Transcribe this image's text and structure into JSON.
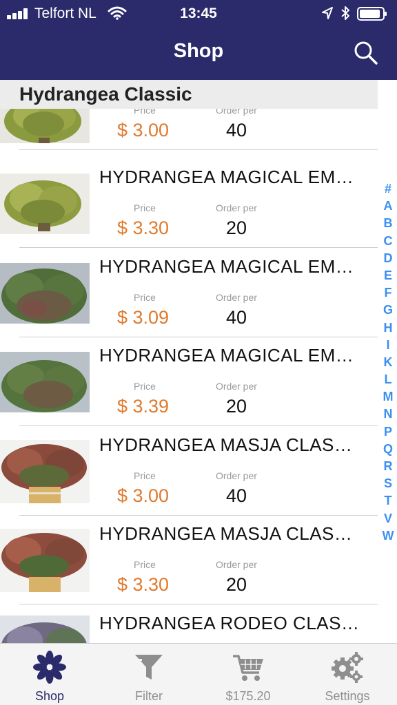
{
  "status_bar": {
    "carrier": "Telfort NL",
    "time": "13:45"
  },
  "nav": {
    "title": "Shop",
    "search_icon": "search-icon"
  },
  "section": {
    "title": "Hydrangea Classic"
  },
  "columns": {
    "price_label": "Price",
    "order_label": "Order per"
  },
  "products": [
    {
      "name": "",
      "price": "$ 3.00",
      "order_per": "40",
      "image_style": "green"
    },
    {
      "name": "HYDRANGEA MAGICAL EM…",
      "price": "$ 3.30",
      "order_per": "20",
      "image_style": "green"
    },
    {
      "name": "HYDRANGEA MAGICAL EM…",
      "price": "$ 3.09",
      "order_per": "40",
      "image_style": "darkgreen"
    },
    {
      "name": "HYDRANGEA MAGICAL EM…",
      "price": "$ 3.39",
      "order_per": "20",
      "image_style": "darkgreen"
    },
    {
      "name": "HYDRANGEA MASJA CLAS…",
      "price": "$ 3.00",
      "order_per": "40",
      "image_style": "red"
    },
    {
      "name": "HYDRANGEA MASJA CLAS…",
      "price": "$ 3.30",
      "order_per": "20",
      "image_style": "red"
    },
    {
      "name": "HYDRANGEA RODEO CLAS…",
      "price": "",
      "order_per": "",
      "image_style": "purple"
    }
  ],
  "alphabet_index": [
    "#",
    "A",
    "B",
    "C",
    "D",
    "E",
    "F",
    "G",
    "H",
    "I",
    "K",
    "L",
    "M",
    "N",
    "P",
    "Q",
    "R",
    "S",
    "T",
    "V",
    "W"
  ],
  "tabs": [
    {
      "label": "Shop",
      "icon": "flower-icon",
      "active": true
    },
    {
      "label": "Filter",
      "icon": "funnel-icon",
      "active": false
    },
    {
      "label": "$175.20",
      "icon": "cart-icon",
      "active": false
    },
    {
      "label": "Settings",
      "icon": "gears-icon",
      "active": false
    }
  ],
  "colors": {
    "nav_background": "#2b2a6b",
    "price": "#e07a2e",
    "index_letters": "#3a8ff0",
    "active_tab": "#2b2a6b",
    "inactive_tab": "#8e8e8e"
  }
}
